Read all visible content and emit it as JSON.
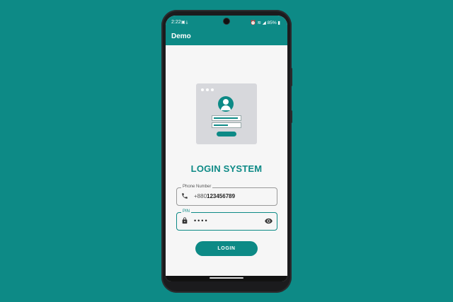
{
  "colors": {
    "background": "#0d8a86",
    "accent": "#0d8a86"
  },
  "status_bar": {
    "time": "2:22",
    "left_icons": [
      "gallery-icon",
      "download-icon"
    ],
    "right_icons": [
      "alarm-icon",
      "wifi-icon",
      "signal-icon"
    ],
    "battery": "85%"
  },
  "app_bar": {
    "title": "Demo"
  },
  "main": {
    "illustration": "login-illustration",
    "title": "LOGIN SYSTEM",
    "phone_field": {
      "label": "Phone Number",
      "icon": "phone-icon",
      "prefix": "+880",
      "value": "123456789"
    },
    "pin_field": {
      "label": "PIN",
      "icon": "lock-icon",
      "value": "••••",
      "visibility_icon": "eye-icon",
      "focused": true
    },
    "login_button": "LOGIN"
  }
}
